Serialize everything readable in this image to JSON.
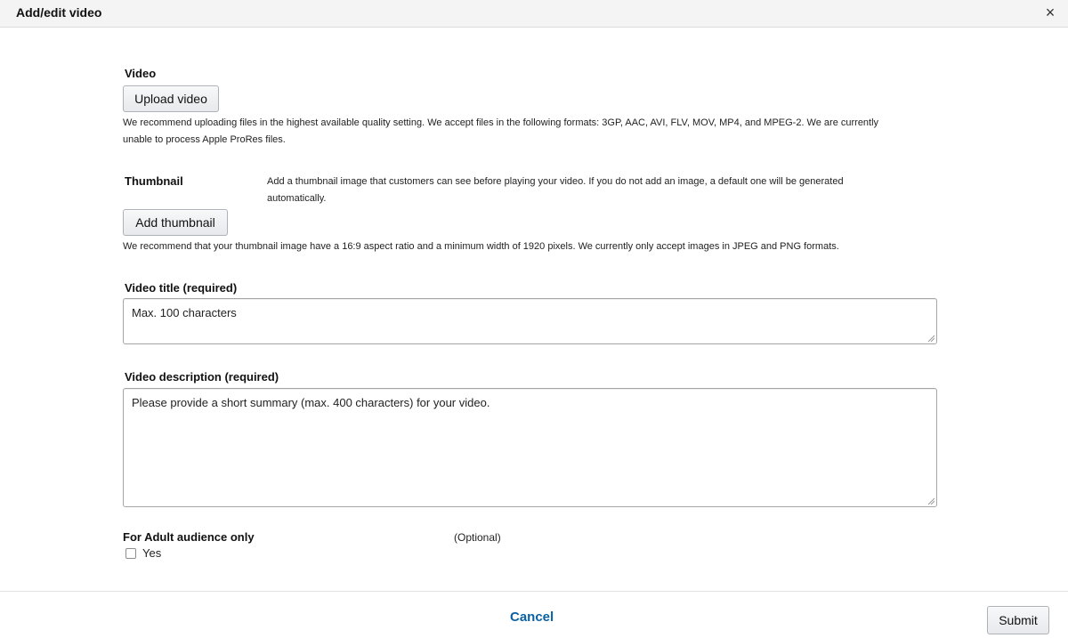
{
  "dialog": {
    "title": "Add/edit video",
    "close_glyph": "×"
  },
  "video": {
    "label": "Video",
    "upload_button": "Upload video",
    "help_line1": "We recommend uploading files in the highest available quality setting. We accept files in the following formats: 3GP, AAC, AVI, FLV, MOV, MP4, and MPEG-2. We are currently",
    "help_line2": "unable to process Apple ProRes files."
  },
  "thumbnail": {
    "label": "Thumbnail",
    "description_line1": "Add a thumbnail image that customers can see before playing your video. If you do not add an image, a default one will be generated",
    "description_line2": "automatically.",
    "add_button": "Add thumbnail",
    "help": "We recommend that your thumbnail image have a 16:9 aspect ratio and a minimum width of 1920 pixels. We currently only accept images in JPEG and PNG formats."
  },
  "title_field": {
    "label": "Video title (required)",
    "placeholder": "Max. 100 characters"
  },
  "description_field": {
    "label": "Video description (required)",
    "placeholder": "Please provide a short summary (max. 400 characters) for your video."
  },
  "adult": {
    "label": "For Adult audience only",
    "optional": "(Optional)",
    "checkbox_label": "Yes"
  },
  "footer": {
    "cancel": "Cancel",
    "submit": "Submit"
  }
}
